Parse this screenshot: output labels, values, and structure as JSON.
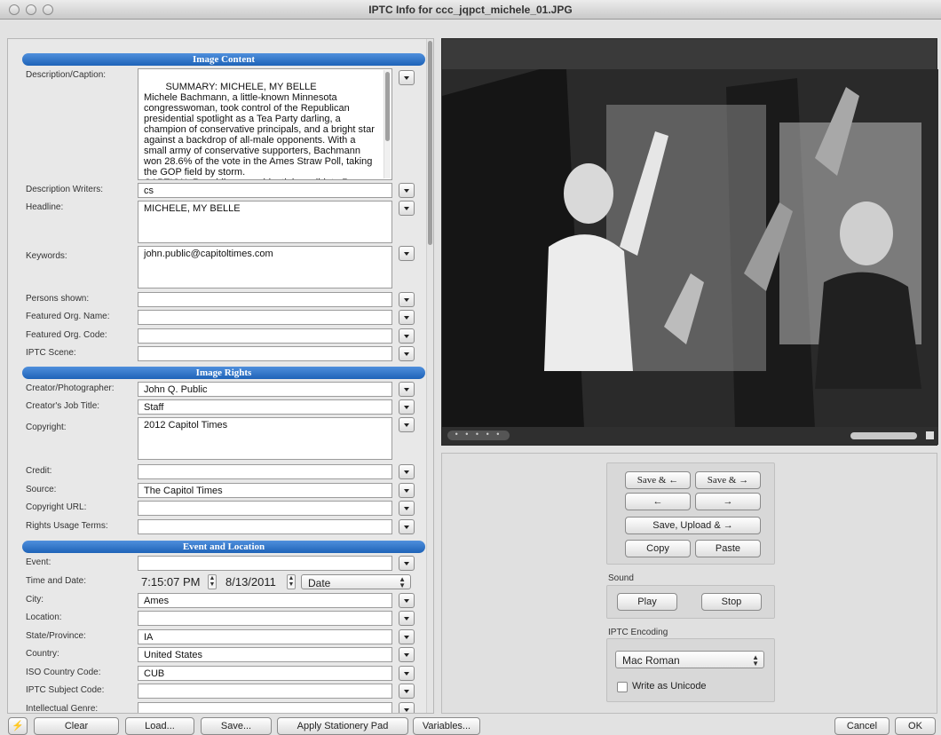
{
  "window": {
    "title": "IPTC Info for ccc_jqpct_michele_01.JPG"
  },
  "sections": {
    "image_content": "Image Content",
    "image_rights": "Image Rights",
    "event_location": "Event and Location"
  },
  "fields": {
    "description_caption": {
      "label": "Description/Caption:",
      "value": "SUMMARY: MICHELE, MY BELLE\nMichele Bachmann, a little-known Minnesota congresswoman, took control of the Republican presidential spotlight as a Tea Party darling, a champion of conservative principals, and a bright star against a backdrop of all-male opponents. With a small army of conservative supporters, Bachmann won 28.6% of the vote in the Ames Straw Poll, taking the GOP field by storm.\nCAPTION: Republican presidential candidate Rep. Michele Bachmann (R-MN) waves to her supporters"
    },
    "description_writers": {
      "label": "Description Writers:",
      "value": "cs"
    },
    "headline": {
      "label": "Headline:",
      "value": "MICHELE, MY BELLE"
    },
    "keywords": {
      "label": "Keywords:",
      "value": "john.public@capitoltimes.com"
    },
    "persons_shown": {
      "label": "Persons shown:",
      "value": ""
    },
    "featured_org_name": {
      "label": "Featured Org. Name:",
      "value": ""
    },
    "featured_org_code": {
      "label": "Featured Org. Code:",
      "value": ""
    },
    "iptc_scene": {
      "label": "IPTC Scene:",
      "value": ""
    },
    "creator_photographer": {
      "label": "Creator/Photographer:",
      "value": "John Q. Public"
    },
    "creator_job_title": {
      "label": "Creator's Job Title:",
      "value": "Staff"
    },
    "copyright": {
      "label": "Copyright:",
      "value": "2012 Capitol Times"
    },
    "credit": {
      "label": "Credit:",
      "value": ""
    },
    "source": {
      "label": "Source:",
      "value": "The Capitol Times"
    },
    "copyright_url": {
      "label": "Copyright URL:",
      "value": ""
    },
    "rights_usage_terms": {
      "label": "Rights Usage Terms:",
      "value": ""
    },
    "event": {
      "label": "Event:",
      "value": ""
    },
    "time_and_date": {
      "label": "Time and Date:",
      "time": "7:15:07 PM",
      "date": "8/13/2011",
      "mode": "Date"
    },
    "city": {
      "label": "City:",
      "value": "Ames"
    },
    "location": {
      "label": "Location:",
      "value": ""
    },
    "state_province": {
      "label": "State/Province:",
      "value": "IA"
    },
    "country": {
      "label": "Country:",
      "value": "United States"
    },
    "iso_country_code": {
      "label": "ISO Country Code:",
      "value": "CUB"
    },
    "iptc_subject_code": {
      "label": "IPTC Subject Code:",
      "value": ""
    },
    "intellectual_genre": {
      "label": "Intellectual Genre:",
      "value": ""
    }
  },
  "controls": {
    "save_prev": "Save & ←",
    "save_next": "Save & →",
    "prev": "←",
    "next": "→",
    "save_upload_next": "Save, Upload & →",
    "copy": "Copy",
    "paste": "Paste",
    "sound_label": "Sound",
    "play": "Play",
    "stop": "Stop",
    "encoding_label": "IPTC Encoding",
    "encoding_value": "Mac Roman",
    "write_unicode": "Write as Unicode"
  },
  "bottom": {
    "lightning": "⚡",
    "clear": "Clear",
    "load": "Load...",
    "save": "Save...",
    "apply_stationery": "Apply Stationery Pad",
    "variables": "Variables...",
    "cancel": "Cancel",
    "ok": "OK"
  }
}
